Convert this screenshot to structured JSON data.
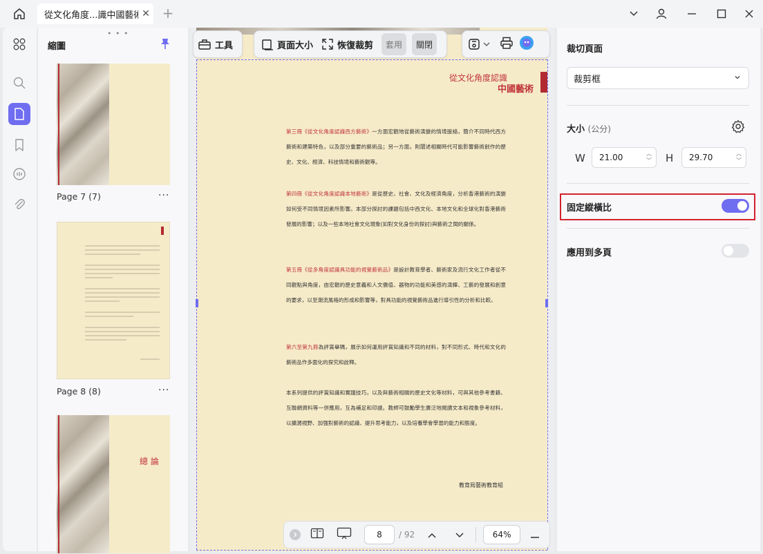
{
  "window": {
    "tab_title": "從文化角度...識中國藝術",
    "tab_close": "✕",
    "new_tab": "+"
  },
  "thumbnails": {
    "header": "縮圖",
    "pages": [
      {
        "label": "Page 7 (7)",
        "more": "···"
      },
      {
        "label": "Page 8 (8)",
        "more": "···"
      },
      {
        "label": "",
        "more": "",
        "text": "總 論"
      }
    ]
  },
  "toolbar": {
    "tools_label": "工具",
    "page_size_label": "頁面大小",
    "restore_crop_label": "恢復裁剪",
    "apply_label": "套用",
    "close_label": "關閉"
  },
  "document": {
    "header_line1": "從文化角度認識",
    "header_line2": "中國藝術",
    "paragraphs": [
      {
        "red": "第三冊《從文化角度認識西方藝術》",
        "text": "一方面宏觀地從藝術演變的情境脈絡，簡介不同時代西方藝術和建築特色，以及部分重要的藝術品；另一方面，則闡述相關時代可能影響藝術創作的歷史、文化、經濟、科技情境和藝術觀等。"
      },
      {
        "red": "第四冊《從文化角度認識本地藝術》",
        "text": "是從歷史、社會、文化及經濟角度，分析香港藝術的演變如何受不同情境因素所影響。本部分探討的課題包括中西文化、本地文化和全球化對香港藝術發展的影響；以及一些本地社會文化現象(如對文化身份的探討)與藝術之間的關係。"
      },
      {
        "red": "第五冊《從多角度認識具功能的視覺藝術品》",
        "text": "是設計教育學者、藝術家及流行文化工作者從不同觀點與角度，由宏觀的歷史意義和人文價值、器物的功能和美感的演繹、工藝的發展和創意的要求，以至潮流風格的形成和影響等，對具功能的視覺藝術品進行導引性的分析和比較。"
      },
      {
        "red": "第六至第九冊",
        "text": "為評賞舉隅，展示如何運用評賞知識和不同的材料，對不同形式、時代和文化的藝術品作多面化的探究和詮釋。"
      },
      {
        "red": "",
        "text": "本系列提供的評賞知識和實踐技巧，以及與藝術相關的歷史文化等材料，可與其他參考書籍、互聯網資料等一併應用，互為補足和印證。教師可鼓勵學生廣泛地閱讀文本和視象參考材料，以擴濶視野、加强對藝術的認識、提升思考能力，以及培養學會學習的能力和態度。"
      }
    ],
    "signature": "教育局藝術教育組"
  },
  "bottom_bar": {
    "current_page": "8",
    "total_pages": "/ 92",
    "zoom": "64%"
  },
  "crop_panel": {
    "title": "裁切頁面",
    "crop_box_value": "裁剪框",
    "size_label": "大小",
    "size_unit": "(公分)",
    "w_label": "W",
    "w_value": "21.00",
    "h_label": "H",
    "h_value": "29.70",
    "lock_ratio_label": "固定縱橫比",
    "lock_ratio_on": true,
    "apply_multi_label": "應用到多頁",
    "apply_multi_on": false
  },
  "colors": {
    "accent": "#6f6df0",
    "highlight_border": "#d3212d",
    "page_bg": "#f6ebc9",
    "doc_red": "#c0353a"
  }
}
